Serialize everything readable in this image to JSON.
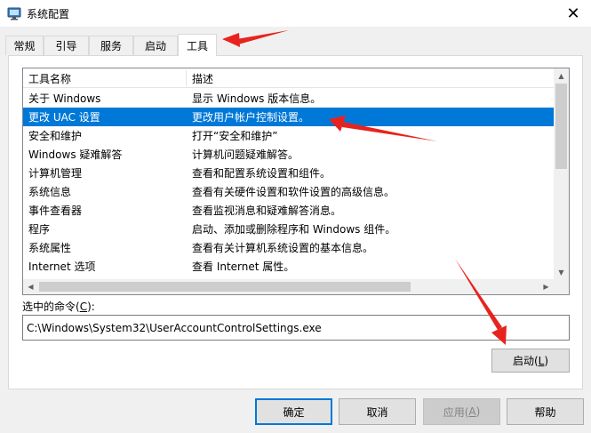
{
  "window": {
    "title": "系统配置",
    "app_icon": "system-config-icon",
    "close_glyph": "✕"
  },
  "tabs": [
    {
      "label": "常规"
    },
    {
      "label": "引导"
    },
    {
      "label": "服务"
    },
    {
      "label": "启动"
    },
    {
      "label": "工具",
      "active": true
    }
  ],
  "list": {
    "columns": [
      "工具名称",
      "描述"
    ],
    "rows": [
      {
        "name": "关于 Windows",
        "desc": "显示 Windows 版本信息。"
      },
      {
        "name": "更改 UAC 设置",
        "desc": "更改用户帐户控制设置。",
        "selected": true
      },
      {
        "name": "安全和维护",
        "desc": "打开“安全和维护”"
      },
      {
        "name": "Windows 疑难解答",
        "desc": "计算机问题疑难解答。"
      },
      {
        "name": "计算机管理",
        "desc": "查看和配置系统设置和组件。"
      },
      {
        "name": "系统信息",
        "desc": "查看有关硬件设置和软件设置的高级信息。"
      },
      {
        "name": "事件查看器",
        "desc": "查看监视消息和疑难解答消息。"
      },
      {
        "name": "程序",
        "desc": "启动、添加或删除程序和 Windows 组件。"
      },
      {
        "name": "系统属性",
        "desc": "查看有关计算机系统设置的基本信息。"
      },
      {
        "name": "Internet 选项",
        "desc": "查看 Internet 属性。"
      }
    ],
    "selection_color": "#0078d7"
  },
  "command": {
    "label_prefix": "选中的命令(",
    "label_key": "C",
    "label_suffix": "):",
    "value": "C:\\Windows\\System32\\UserAccountControlSettings.exe"
  },
  "launch_button": {
    "prefix": "启动(",
    "key": "L",
    "suffix": ")"
  },
  "buttons": {
    "ok": "确定",
    "cancel": "取消",
    "apply_prefix": "应用(",
    "apply_key": "A",
    "apply_suffix": ")",
    "help": "帮助"
  },
  "annotation_color": "#e8231e"
}
